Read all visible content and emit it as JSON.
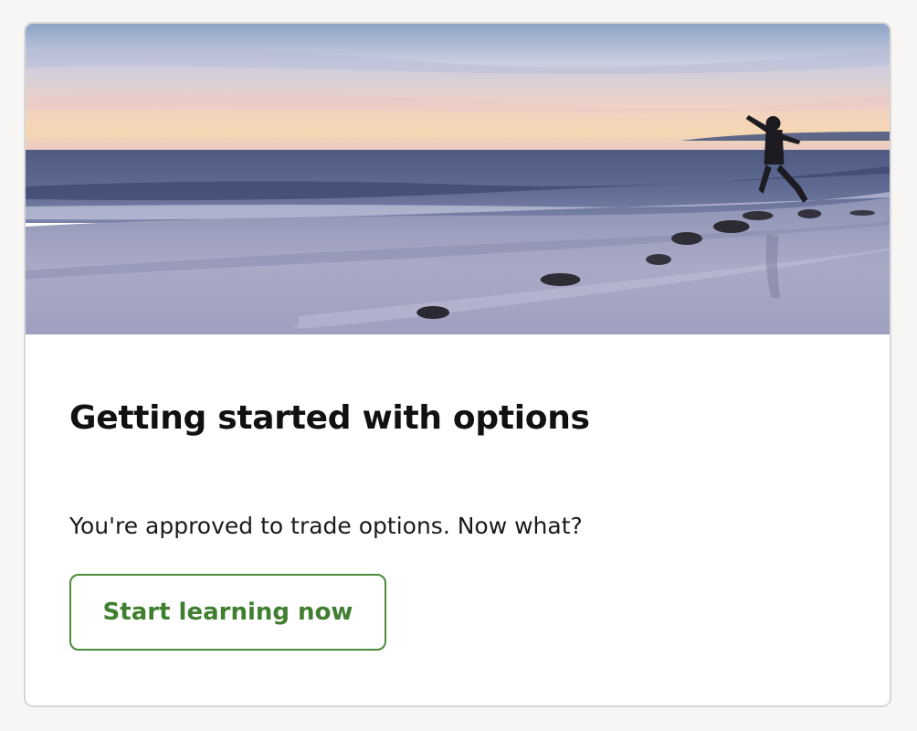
{
  "card": {
    "title": "Getting started with options",
    "description": "You're approved to trade options. Now what?",
    "cta_label": "Start learning now"
  },
  "colors": {
    "accent": "#3f7f2f",
    "card_border": "#d8d8d8",
    "page_background": "#f7f6f4"
  }
}
